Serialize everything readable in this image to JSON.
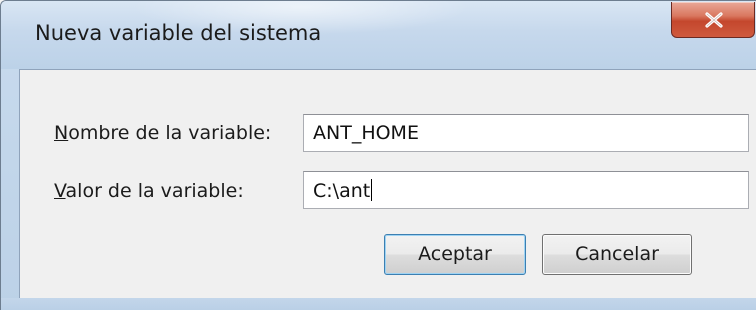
{
  "dialog": {
    "title": "Nueva variable del sistema",
    "close_symbol": "X",
    "close_icon": "close-icon"
  },
  "form": {
    "name_label_mnemonic": "N",
    "name_label_rest": "ombre de la variable:",
    "name_value": "ANT_HOME",
    "value_label_mnemonic": "V",
    "value_label_rest": "alor de la variable:",
    "value_value": "C:\\ant"
  },
  "buttons": {
    "ok_label": "Aceptar",
    "cancel_label": "Cancelar"
  },
  "colors": {
    "frame": "#c2d6ea",
    "close_button": "#c4472d",
    "client_background": "#f0f0f0",
    "default_button_border": "#3c7fb1"
  }
}
